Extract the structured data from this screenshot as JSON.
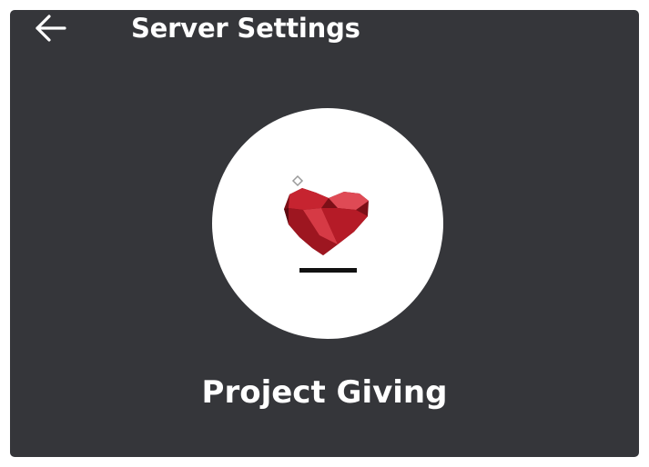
{
  "header": {
    "title": "Server Settings",
    "back_icon": "arrow-left-icon"
  },
  "server": {
    "name": "Project Giving",
    "icon": "heart-logo-icon"
  },
  "colors": {
    "background": "#35363a",
    "text": "#ffffff",
    "icon_background": "#ffffff",
    "heart_red": "#c8232f"
  }
}
